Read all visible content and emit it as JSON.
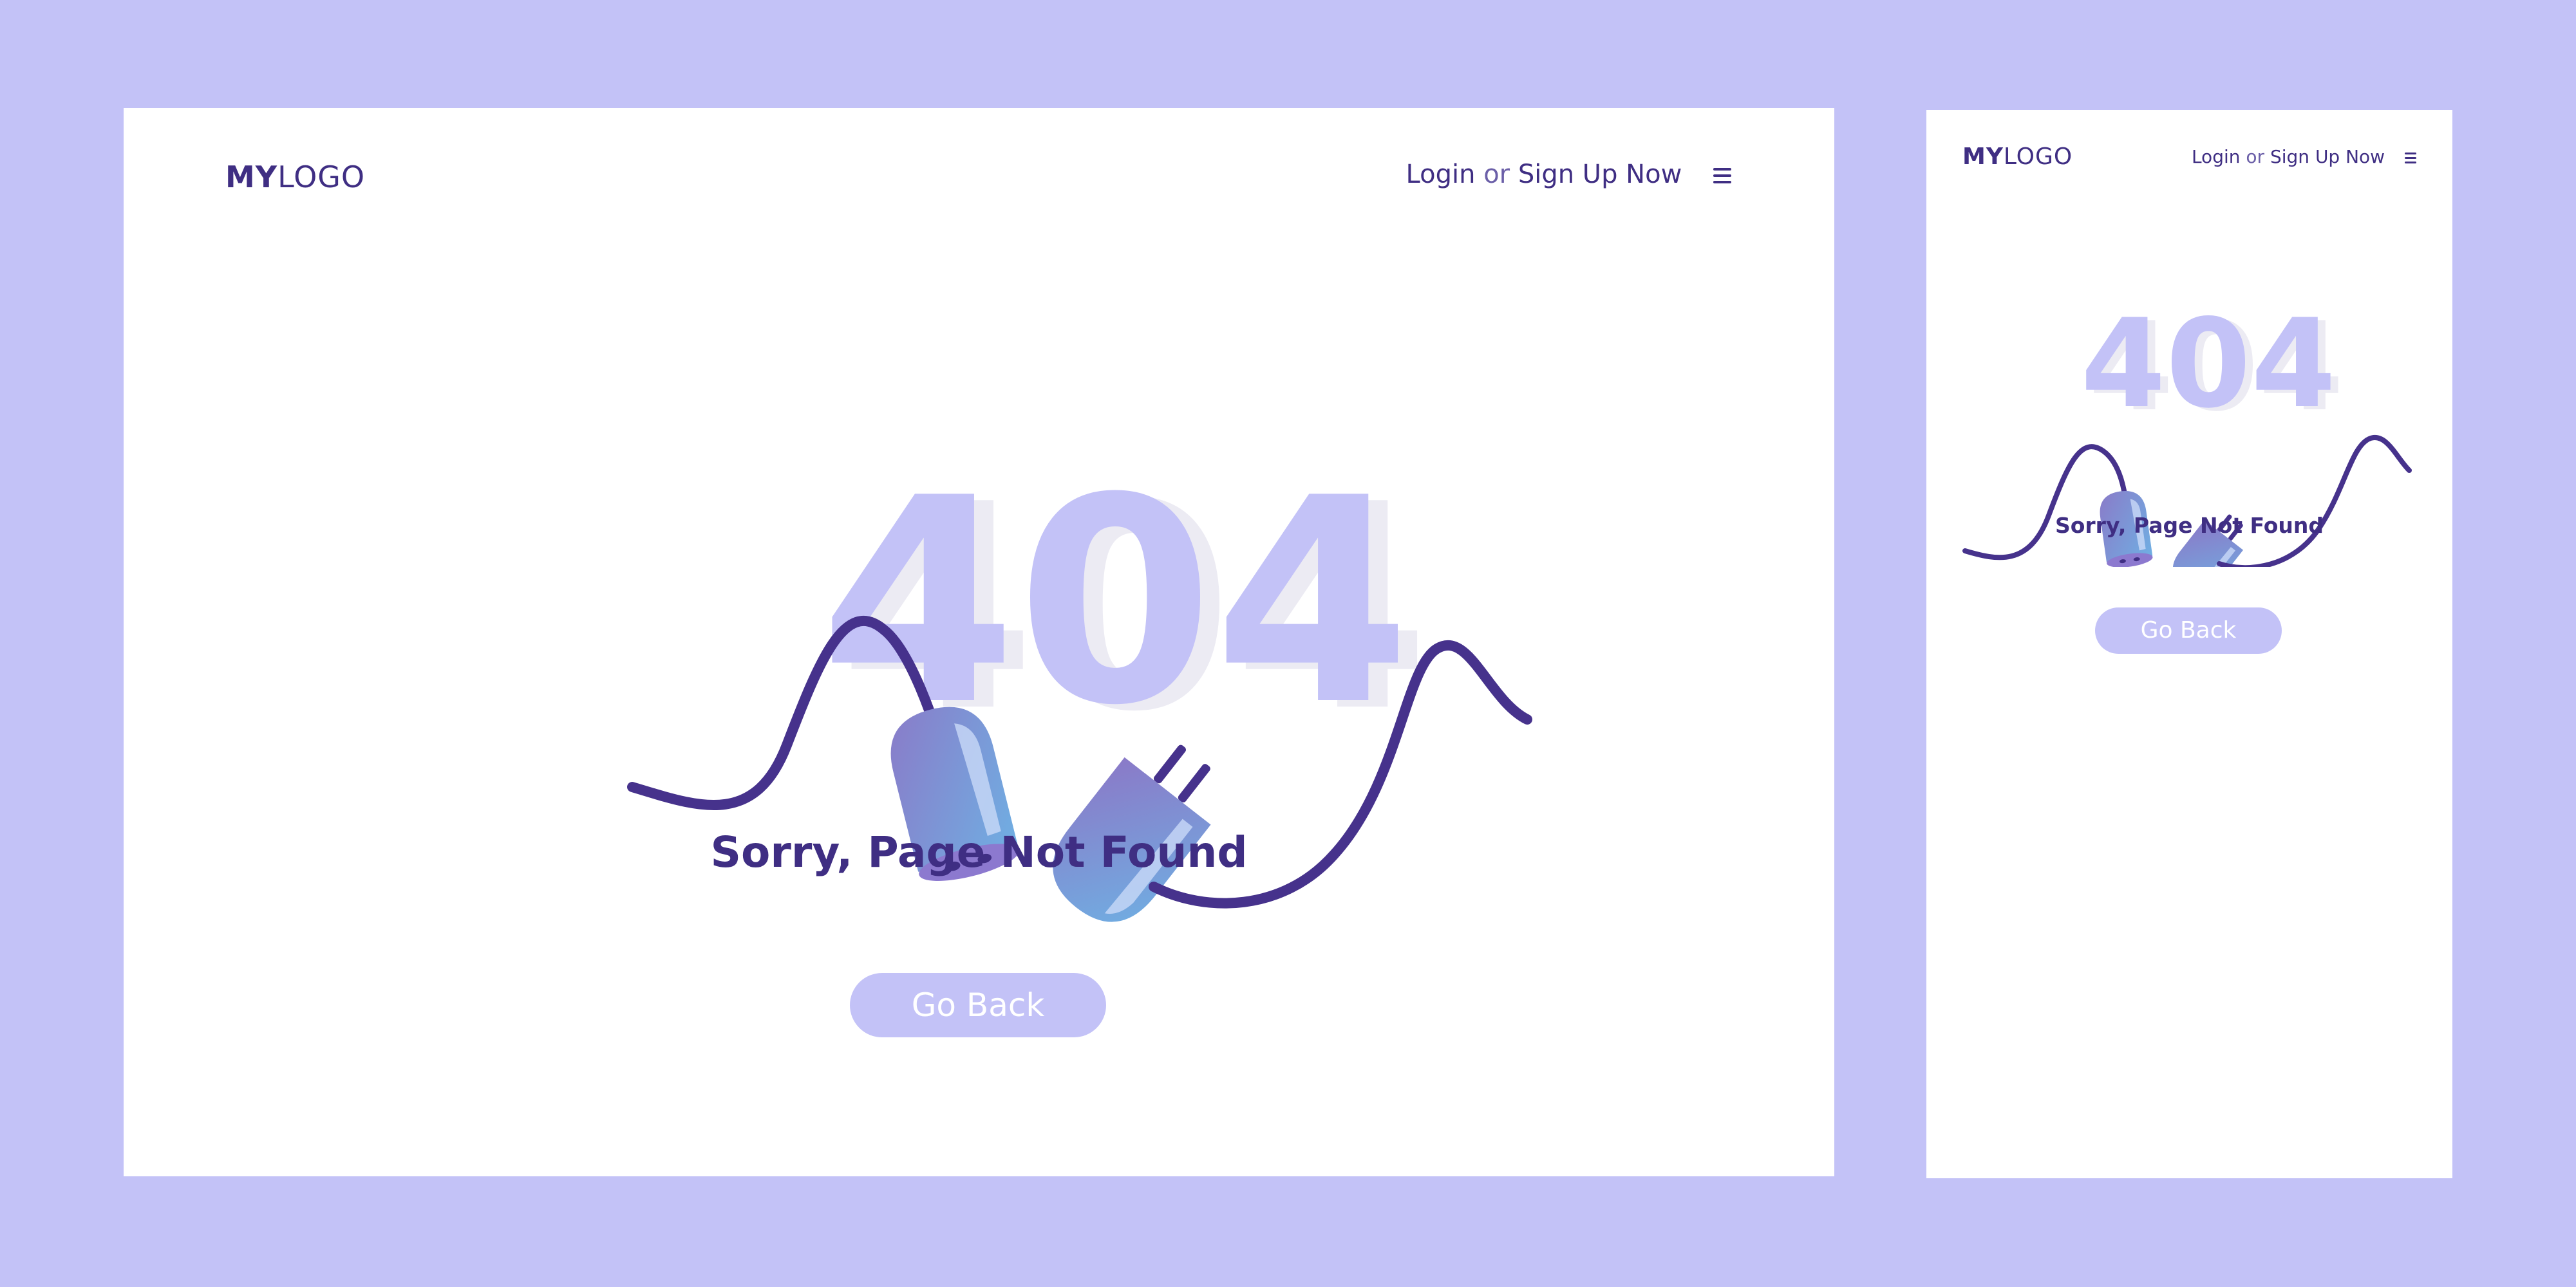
{
  "colors": {
    "background": "#c3c2f7",
    "frame": "#ffffff",
    "primary_text": "#3f2e83",
    "accent": "#c3c2f7",
    "cable": "#46328c",
    "plug_gradient_start": "#8a7ac8",
    "plug_gradient_end": "#6fb0e3"
  },
  "desktop": {
    "logo": {
      "bold": "MY",
      "light": "LOGO"
    },
    "nav": {
      "login": "Login",
      "or": "or",
      "signup": "Sign Up Now",
      "menu_icon": "hamburger-icon"
    },
    "error_code": "404",
    "message": "Sorry, Page Not Found",
    "button_label": "Go Back"
  },
  "mobile": {
    "logo": {
      "bold": "MY",
      "light": "LOGO"
    },
    "nav": {
      "login": "Login",
      "or": "or",
      "signup": "Sign Up Now",
      "menu_icon": "hamburger-icon"
    },
    "error_code": "404",
    "message": "Sorry, Page Not Found",
    "button_label": "Go Back"
  }
}
